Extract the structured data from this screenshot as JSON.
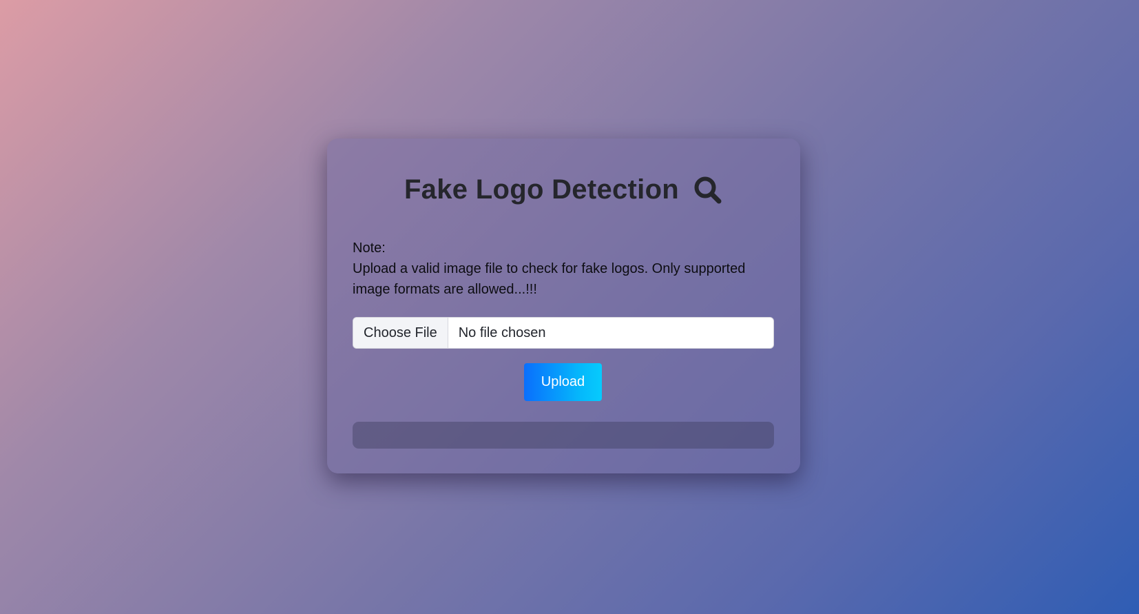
{
  "header": {
    "title": "Fake Logo Detection",
    "icon": "search-icon"
  },
  "note": {
    "label": "Note:",
    "text": "Upload a valid image file to check for fake logos. Only supported image formats are allowed...!!!"
  },
  "file_input": {
    "button_label": "Choose File",
    "status": "No file chosen"
  },
  "actions": {
    "upload_label": "Upload"
  },
  "result": {
    "text": ""
  },
  "colors": {
    "title": "#25262c",
    "upload_gradient_start": "#0a6ffc",
    "upload_gradient_end": "#06cbfd"
  }
}
